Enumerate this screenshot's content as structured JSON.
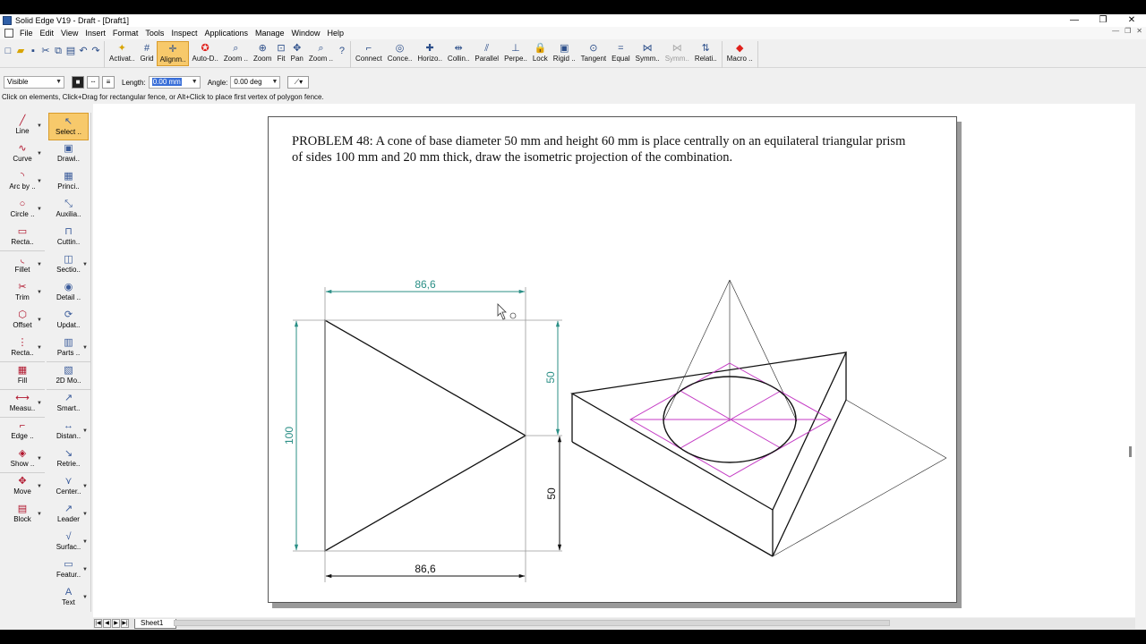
{
  "window": {
    "title": "Solid Edge V19 - Draft - [Draft1]",
    "minimize": "—",
    "maximize": "❐",
    "close": "✕"
  },
  "menu": {
    "items": [
      "File",
      "Edit",
      "View",
      "Insert",
      "Format",
      "Tools",
      "Inspect",
      "Applications",
      "Manage",
      "Window",
      "Help"
    ]
  },
  "toolbar": {
    "select_label": "Select ..",
    "buttons": [
      {
        "label": "Activat..",
        "icon": "✦"
      },
      {
        "label": "Grid",
        "icon": "#"
      },
      {
        "label": "Alignm..",
        "icon": "✛"
      },
      {
        "label": "Auto-D..",
        "icon": "✪"
      },
      {
        "label": "Zoom ..",
        "icon": "⌕"
      },
      {
        "label": "Zoom",
        "icon": "⊕"
      },
      {
        "label": "Fit",
        "icon": "⊡"
      },
      {
        "label": "Pan",
        "icon": "✥"
      },
      {
        "label": "Zoom ..",
        "icon": "⌕"
      }
    ],
    "relations": [
      {
        "label": "Connect",
        "icon": "⌐"
      },
      {
        "label": "Conce..",
        "icon": "◎"
      },
      {
        "label": "Horizo..",
        "icon": "✚"
      },
      {
        "label": "Collin..",
        "icon": "⇹"
      },
      {
        "label": "Parallel",
        "icon": "⫽"
      },
      {
        "label": "Perpe..",
        "icon": "⊥"
      },
      {
        "label": "Lock",
        "icon": "🔒"
      },
      {
        "label": "Rigid ..",
        "icon": "▣"
      },
      {
        "label": "Tangent",
        "icon": "⊙"
      },
      {
        "label": "Equal",
        "icon": "="
      },
      {
        "label": "Symm..",
        "icon": "⋈"
      },
      {
        "label": "Symm..",
        "icon": "⋈"
      },
      {
        "label": "Relati..",
        "icon": "⇅"
      }
    ],
    "macro_label": "Macro .."
  },
  "ribbon": {
    "layer_value": "Visible",
    "length_label": "Length:",
    "length_value": "0.00 mm",
    "angle_label": "Angle:",
    "angle_value": "0.00 deg"
  },
  "prompt": "Click on elements, Click+Drag for rectangular fence, or Alt+Click to place first vertex of polygon fence.",
  "left_tools": [
    {
      "label": "Line",
      "icon": "╱"
    },
    {
      "label": "Curve",
      "icon": "∿"
    },
    {
      "label": "Arc by ..",
      "icon": "◝"
    },
    {
      "label": "Circle ..",
      "icon": "○"
    },
    {
      "label": "Recta..",
      "icon": "▭"
    },
    {
      "label": "Fillet",
      "icon": "◟"
    },
    {
      "label": "Trim",
      "icon": "✂"
    },
    {
      "label": "Offset",
      "icon": "⬡"
    },
    {
      "label": "Recta..",
      "icon": "⋮"
    },
    {
      "label": "Fill",
      "icon": "▦"
    },
    {
      "label": "Measu..",
      "icon": "⟷"
    },
    {
      "label": "Edge ..",
      "icon": "⌐"
    },
    {
      "label": "Show ..",
      "icon": "◈"
    },
    {
      "label": "Move",
      "icon": "✥"
    },
    {
      "label": "Block",
      "icon": "▤"
    }
  ],
  "right_tools": [
    {
      "label": "Select ..",
      "icon": "↖"
    },
    {
      "label": "Drawi..",
      "icon": "▣"
    },
    {
      "label": "Princi..",
      "icon": "▦"
    },
    {
      "label": "Auxilia..",
      "icon": "⤡"
    },
    {
      "label": "Cuttin..",
      "icon": "⊓"
    },
    {
      "label": "Sectio..",
      "icon": "◫"
    },
    {
      "label": "Detail ..",
      "icon": "◉"
    },
    {
      "label": "Updat..",
      "icon": "⟳"
    },
    {
      "label": "Parts ..",
      "icon": "▥"
    },
    {
      "label": "2D Mo..",
      "icon": "▧"
    },
    {
      "label": "Smart..",
      "icon": "↗"
    },
    {
      "label": "Distan..",
      "icon": "↔"
    },
    {
      "label": "Retrie..",
      "icon": "↘"
    },
    {
      "label": "Center..",
      "icon": "⋎"
    },
    {
      "label": "Leader",
      "icon": "↗"
    },
    {
      "label": "Surfac..",
      "icon": "√"
    },
    {
      "label": "Featur..",
      "icon": "▭"
    },
    {
      "label": "Text",
      "icon": "A"
    }
  ],
  "problem_text": "PROBLEM 48: A cone of base diameter 50 mm and height 60 mm is place centrally on an equilateral triangular prism of sides 100 mm and 20 mm thick, draw the isometric projection of the combination.",
  "dimensions": {
    "top_width": "86,6",
    "bottom_width": "86,6",
    "left_height": "100",
    "right_upper": "50",
    "right_lower": "50"
  },
  "colors": {
    "dimension_teal": "#2b8f86",
    "construction_magenta": "#c43ac4",
    "active_tool": "#f7c96b"
  },
  "sheet_tab": "Sheet1"
}
